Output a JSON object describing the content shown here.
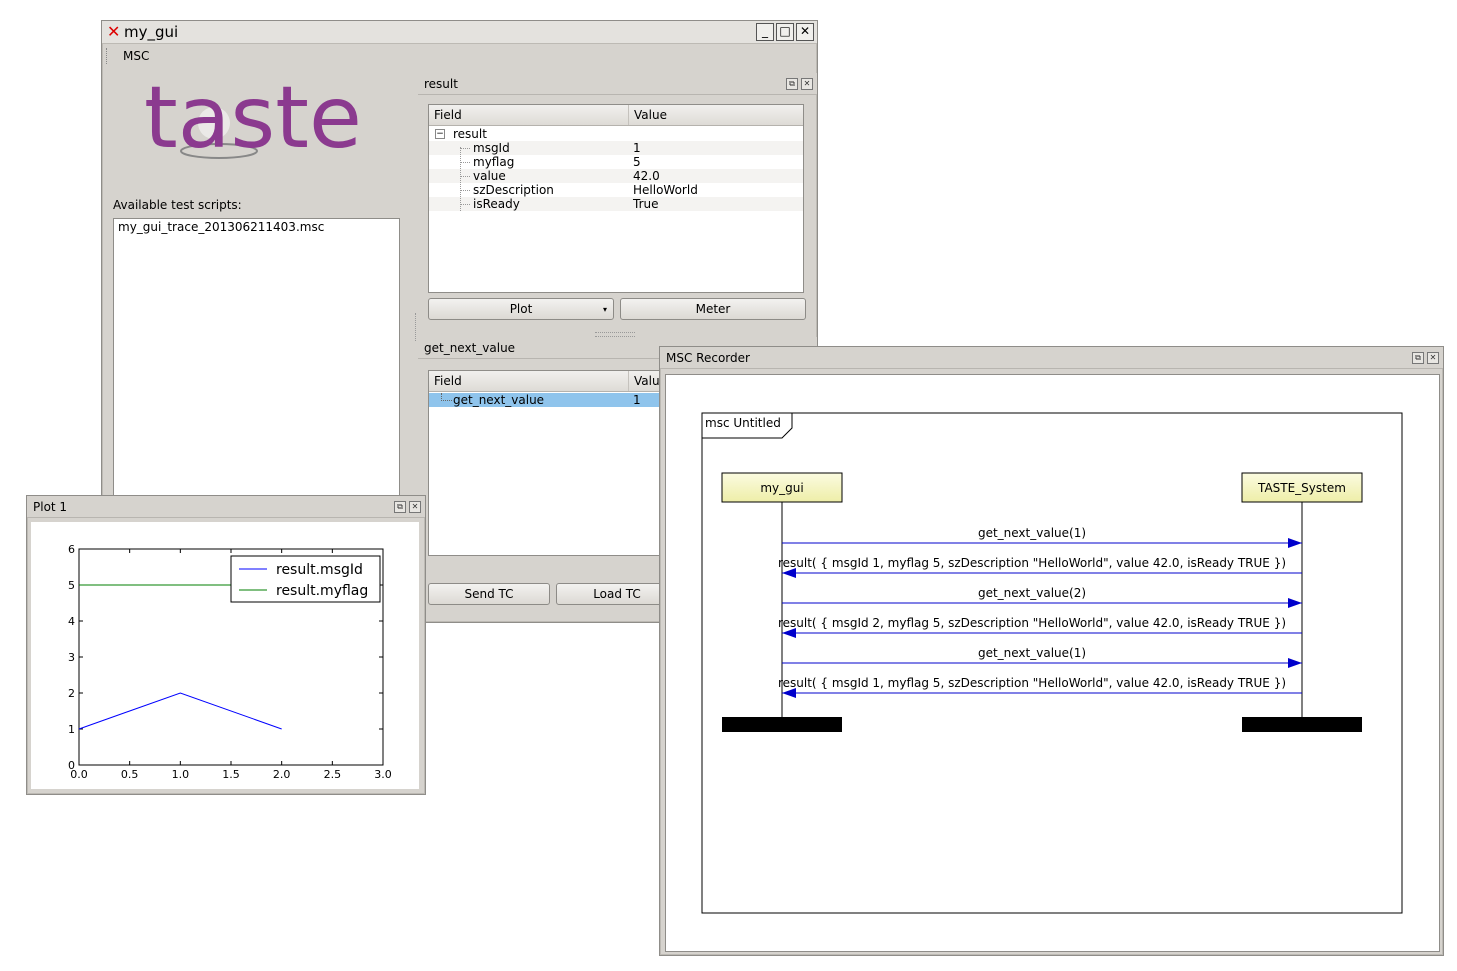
{
  "main_window": {
    "title": "my_gui",
    "menu": [
      "MSC"
    ],
    "logo_text": "taste",
    "scripts_label": "Available test scripts:",
    "scripts": [
      "my_gui_trace_201306211403.msc"
    ]
  },
  "result_dock": {
    "title": "result",
    "header_field": "Field",
    "header_value": "Value",
    "root_label": "result",
    "rows": [
      {
        "field": "msgId",
        "value": "1"
      },
      {
        "field": "myflag",
        "value": "5"
      },
      {
        "field": "value",
        "value": "42.0"
      },
      {
        "field": "szDescription",
        "value": "HelloWorld"
      },
      {
        "field": "isReady",
        "value": "True"
      }
    ],
    "plot_button": "Plot",
    "meter_button": "Meter"
  },
  "get_next_value_dock": {
    "title": "get_next_value",
    "header_field": "Field",
    "header_value": "Valu",
    "row_field": "get_next_value",
    "row_value": "1",
    "send_button": "Send TC",
    "load_button": "Load TC"
  },
  "plot_window": {
    "title": "Plot 1",
    "chart_data": {
      "type": "line",
      "title": "",
      "xlabel": "",
      "ylabel": "",
      "xlim": [
        0.0,
        3.0
      ],
      "ylim": [
        0,
        6
      ],
      "xticks": [
        "0.0",
        "0.5",
        "1.0",
        "1.5",
        "2.0",
        "2.5",
        "3.0"
      ],
      "yticks": [
        "0",
        "1",
        "2",
        "3",
        "4",
        "5",
        "6"
      ],
      "legend_position": "top-right",
      "series": [
        {
          "name": "result.msgId",
          "color": "#0000ff",
          "x": [
            0,
            1,
            2
          ],
          "y": [
            1,
            2,
            1
          ]
        },
        {
          "name": "result.myflag",
          "color": "#007f00",
          "x": [
            0,
            1,
            2
          ],
          "y": [
            5,
            5,
            5
          ]
        }
      ]
    }
  },
  "msc_window": {
    "title": "MSC Recorder",
    "frame_label": "msc Untitled",
    "instances": [
      "my_gui",
      "TASTE_System"
    ],
    "messages": [
      {
        "label": "get_next_value(1)",
        "direction": "right"
      },
      {
        "label": "result( { msgId 1, myflag 5, szDescription \"HelloWorld\", value 42.0, isReady TRUE })",
        "direction": "left"
      },
      {
        "label": "get_next_value(2)",
        "direction": "right"
      },
      {
        "label": "result( { msgId 2, myflag 5, szDescription \"HelloWorld\", value 42.0, isReady TRUE })",
        "direction": "left"
      },
      {
        "label": "get_next_value(1)",
        "direction": "right"
      },
      {
        "label": "result( { msgId 1, myflag 5, szDescription \"HelloWorld\", value 42.0, isReady TRUE })",
        "direction": "left"
      }
    ]
  }
}
